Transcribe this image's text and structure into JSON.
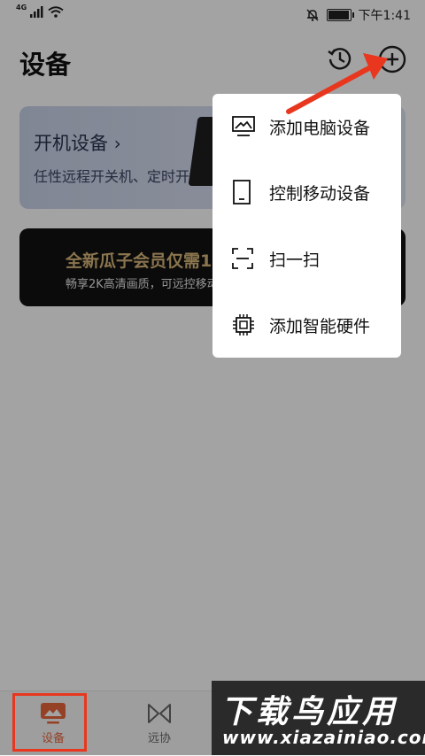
{
  "status_bar": {
    "network": "4G",
    "time": "下午1:41",
    "battery_level": 0.9
  },
  "header": {
    "title": "设备"
  },
  "cards": {
    "power": {
      "title": "开机设备",
      "subtitle": "任性远程开关机、定时开"
    },
    "vip": {
      "title": "全新瓜子会员仅需1",
      "subtitle": "畅享2K高清画质，可远控移动"
    }
  },
  "menu": {
    "items": [
      {
        "label": "添加电脑设备",
        "icon": "monitor-icon"
      },
      {
        "label": "控制移动设备",
        "icon": "tablet-icon"
      },
      {
        "label": "扫一扫",
        "icon": "scan-icon"
      },
      {
        "label": "添加智能硬件",
        "icon": "chip-icon"
      }
    ]
  },
  "bottom_nav": {
    "items": [
      {
        "label": "设备",
        "icon": "devices-icon",
        "active": true
      },
      {
        "label": "远协",
        "icon": "remote-assist-icon",
        "active": false
      }
    ]
  },
  "watermark": {
    "text": "下载鸟应用",
    "url": "www.xiazainiao.com"
  },
  "colors": {
    "accent": "#e8663c",
    "annotation": "#e8371e",
    "overlay": "rgba(0,0,0,0.36)"
  }
}
